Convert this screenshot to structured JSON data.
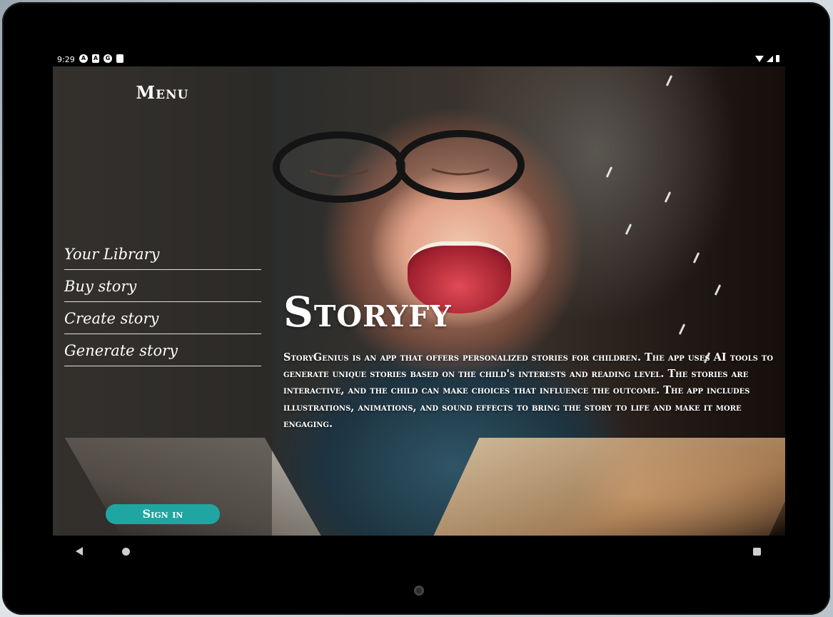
{
  "status_bar": {
    "time": "9:29",
    "left_icons": [
      "A",
      "A",
      "G",
      "sd-card"
    ]
  },
  "menu": {
    "title": "Menu",
    "items": [
      {
        "label": "Your Library"
      },
      {
        "label": "Buy story"
      },
      {
        "label": "Create story"
      },
      {
        "label": "Generate story"
      }
    ],
    "sign_in_label": "Sign in"
  },
  "main": {
    "title": "Storyfy",
    "description": "StoryGenius is an app that offers personalized stories for children. The app uses AI tools to generate unique stories based on the child's interests and reading level. The stories are interactive, and the child can make choices that influence the outcome. The app includes illustrations, animations, and sound effects to bring the story to life and make it more engaging."
  },
  "colors": {
    "accent": "#1fa6a3",
    "menu_overlay": "#2d2824"
  },
  "icons": {
    "back": "triangle-back-icon",
    "home": "circle-home-icon",
    "recent": "square-recents-icon"
  }
}
